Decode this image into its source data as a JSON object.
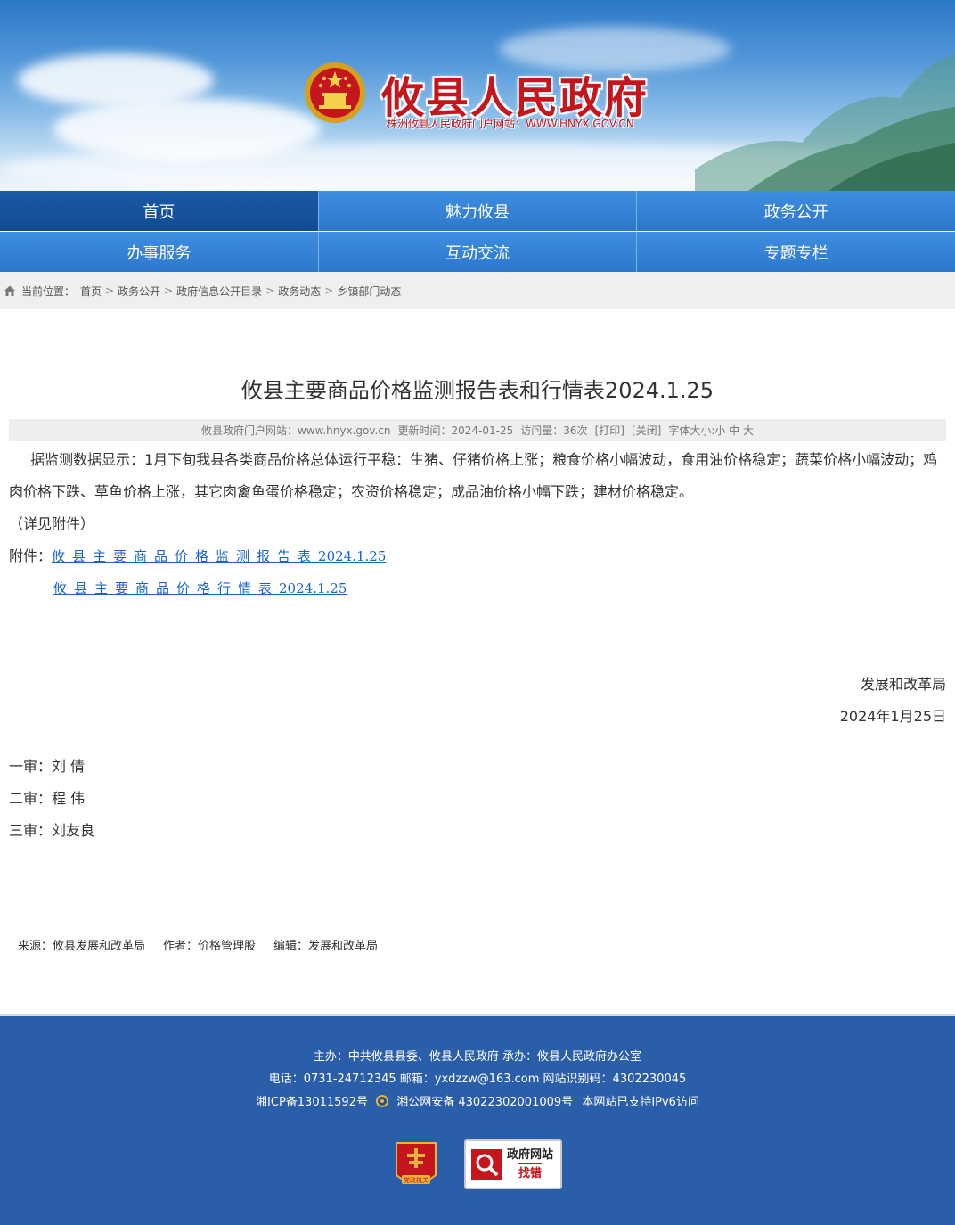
{
  "header": {
    "title": "攸县人民政府",
    "subtitle": "株洲攸县人民政府门户网站：WWW.HNYX.GOV.CN",
    "emblem_icon": "national-emblem-icon"
  },
  "nav": {
    "row1": [
      "首页",
      "魅力攸县",
      "政务公开"
    ],
    "row2": [
      "办事服务",
      "互动交流",
      "专题专栏"
    ],
    "active": "首页"
  },
  "breadcrumb": {
    "label": "当前位置：",
    "items": [
      "首页",
      "政务公开",
      "政府信息公开目录",
      "政务动态",
      "乡镇部门动态"
    ],
    "separator": ">"
  },
  "article": {
    "title": "攸县主要商品价格监测报告表和行情表2024.1.25",
    "meta": {
      "site": "攸县政府门户网站：www.hnyx.gov.cn",
      "updated": "更新时间：2024-01-25",
      "visits": "访问量：36次",
      "print": "[打印]",
      "close": "[关闭]",
      "font_size": "字体大小:小 中 大"
    },
    "body": "据监测数据显示：1月下旬我县各类商品价格总体运行平稳：生猪、仔猪价格上涨；粮食价格小幅波动，食用油价格稳定；蔬菜价格小幅波动；鸡肉价格下跌、草鱼价格上涨，其它肉禽鱼蛋价格稳定；农资价格稳定；成品油价格小幅下跌；建材价格稳定。",
    "note": "（详见附件）",
    "attachments_label": "附件：",
    "attachments": [
      {
        "text": "攸县主要商品价格监测报告表",
        "num": "2024.1.25"
      },
      {
        "text": "攸县主要商品价格行情表",
        "num": "2024.1.25"
      }
    ],
    "signature": "发展和改革局",
    "date": "2024年1月25日",
    "reviews": [
      "一审：刘 倩",
      "二审：程 伟",
      "三审：刘友良"
    ],
    "source": "来源：攸县发展和改革局",
    "author": "作者：价格管理股",
    "editor": "编辑：发展和改革局"
  },
  "footer": {
    "line1": "主办：中共攸县县委、攸县人民政府 承办：攸县人民政府办公室",
    "line2": "电话：0731-24712345  邮箱：yxdzzw@163.com  网站识别码：4302230045",
    "icp": "湘ICP备13011592号",
    "police": "湘公网安备 43022302001009号",
    "ipv6": "本网站已支持IPv6访问",
    "badge_party": "党政机关",
    "badge_error_top": "政府网站",
    "badge_error_bottom": "找错"
  }
}
